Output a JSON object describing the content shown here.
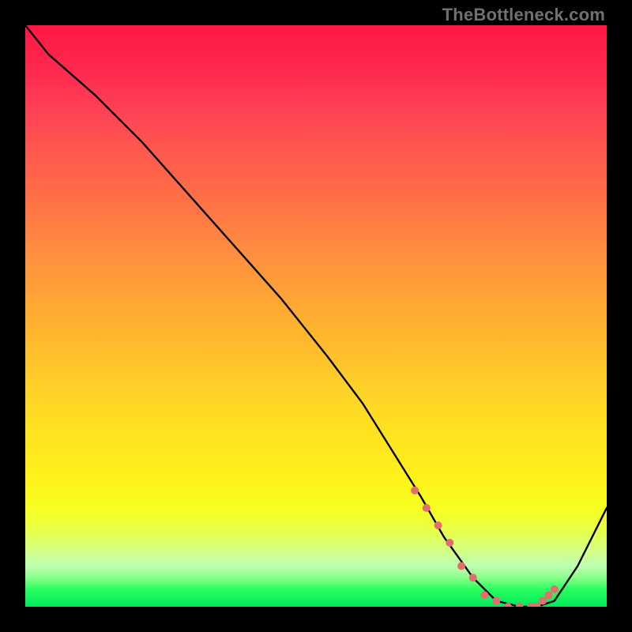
{
  "attribution": "TheBottleneck.com",
  "chart_data": {
    "type": "line",
    "title": "",
    "xlabel": "",
    "ylabel": "",
    "xlim": [
      0,
      100
    ],
    "ylim": [
      0,
      100
    ],
    "grid": false,
    "legend": false,
    "gradient_background": {
      "top": "#ff1744",
      "mid": "#ffe220",
      "bottom": "#00e85a"
    },
    "series": [
      {
        "name": "bottleneck-curve",
        "color": "#000000",
        "x": [
          0,
          4,
          12,
          20,
          28,
          36,
          44,
          52,
          58,
          63,
          68,
          72,
          77,
          81,
          85,
          88,
          91,
          95,
          100
        ],
        "y": [
          100,
          95,
          88,
          80,
          71,
          62,
          53,
          43,
          35,
          27,
          19,
          12,
          5,
          1,
          0,
          0,
          1,
          7,
          17
        ]
      }
    ],
    "markers": {
      "name": "highlight-dots",
      "color": "#e36e6e",
      "radius": 5,
      "x": [
        67,
        69,
        71,
        73,
        75,
        77,
        79,
        81,
        83,
        85,
        87,
        88,
        89,
        90,
        91
      ],
      "y": [
        20,
        17,
        14,
        11,
        7,
        5,
        2,
        1,
        0,
        0,
        0,
        0,
        1,
        2,
        3
      ]
    }
  }
}
